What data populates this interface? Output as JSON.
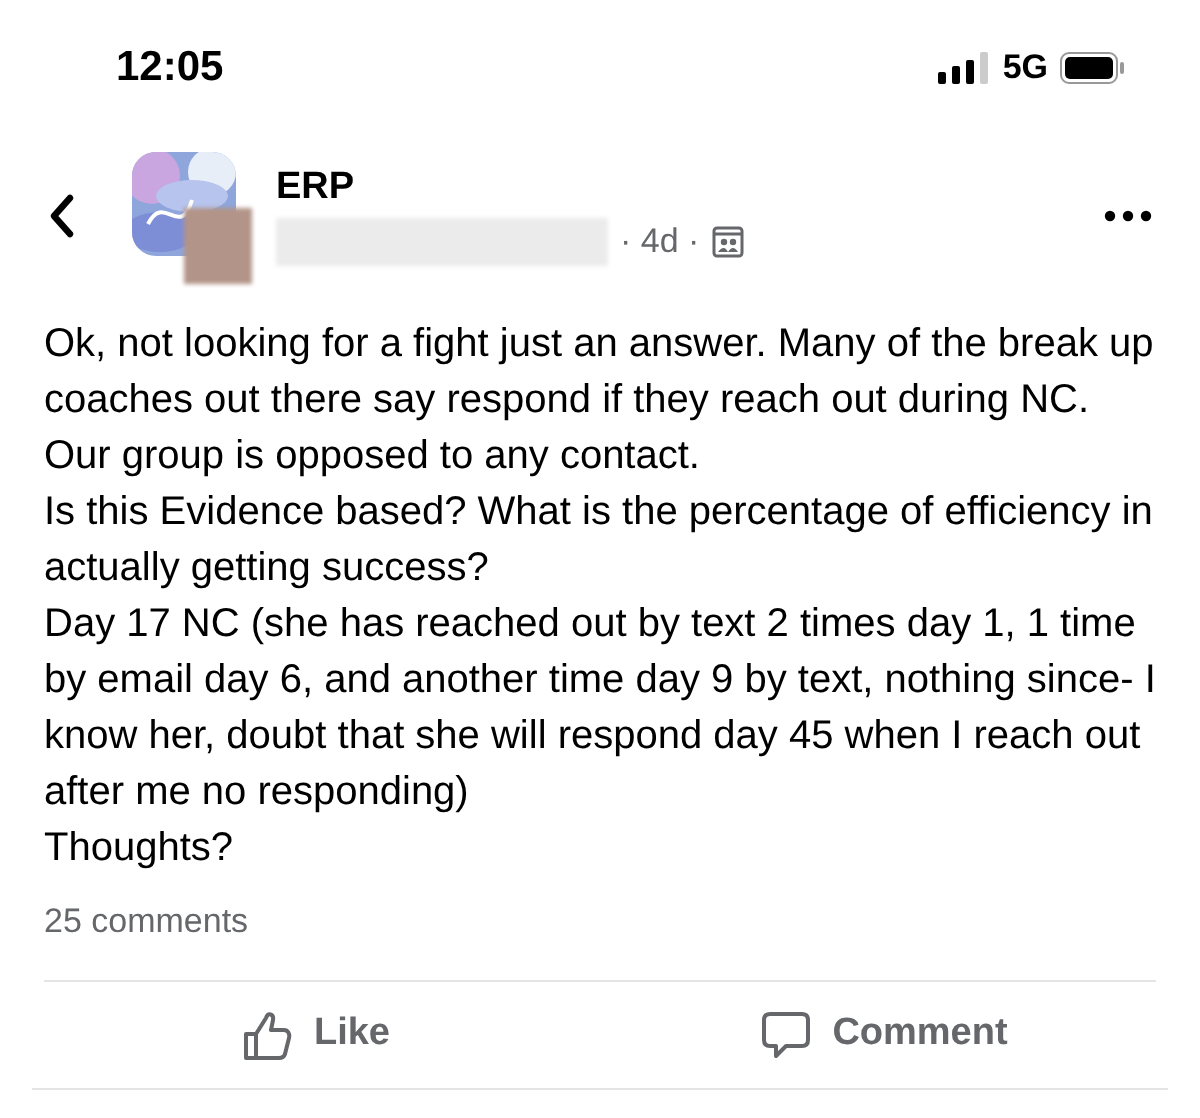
{
  "status_bar": {
    "time": "12:05",
    "network": "5G"
  },
  "post": {
    "group": "ERP",
    "age": "· 4d ·",
    "paragraphs": [
      "Ok, not looking for a fight just an answer. Many of the break up coaches out there say respond if they reach out during NC. Our group is opposed to any contact.",
      "Is this Evidence based? What is the percentage of efficiency in actually getting success?",
      "Day 17 NC (she has reached out by text 2 times day 1, 1 time by email day 6, and another time day 9 by text, nothing since- I know her, doubt that she will respond day 45 when I reach out after me no responding)",
      "Thoughts?"
    ],
    "comment_count": "25 comments"
  },
  "actions": [
    {
      "kind": "like",
      "label": "Like"
    },
    {
      "kind": "comment",
      "label": "Comment"
    }
  ]
}
